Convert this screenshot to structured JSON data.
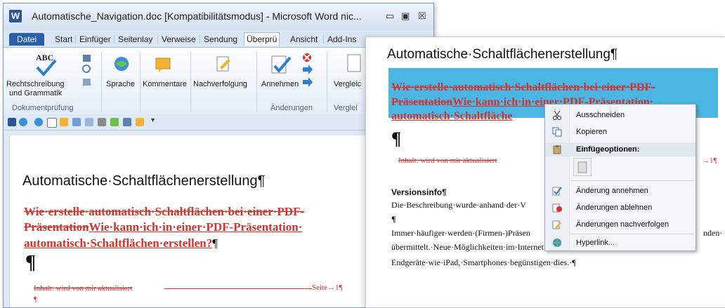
{
  "window": {
    "app_icon_letter": "W",
    "title": "Automatische_Navigation.doc [Kompatibilitätsmodus] - Microsoft Word nic...",
    "controls": [
      "▭",
      "▣",
      "☒"
    ]
  },
  "ribbon_tabs": [
    "Datei",
    "Start",
    "Einfüger",
    "Seitenlay",
    "Verweise",
    "Sendung",
    "Überprü",
    "Ansicht",
    "Add-Ins"
  ],
  "ribbon": {
    "proofing_label_1": "Rechtschreibung",
    "proofing_label_2": "und Grammatik",
    "proofing_group": "Dokumentprüfung",
    "language": "Sprache",
    "comments": "Kommentare",
    "tracking": "Nachverfolgung",
    "accept": "Annehmen",
    "changes_group": "Änderungen",
    "compare": "Vergleic",
    "compare_group": "Verglei"
  },
  "document": {
    "heading": "Automatische·Schaltflächenerstellung¶",
    "struck_line1": "Wie·erstelle·automatisch·Schaltflächen·bei·einer·PDF-",
    "struck_line2a": "Präsentation",
    "inserted_line2b": "Wie·kann·ich·in·einer·PDF-Präsentation·",
    "inserted_line3": "automatisch·Schaltflächen·erstellen?",
    "pilcrow": "¶",
    "toc_entry": "Inhalt: wird von mir aktualisiert",
    "toc_tab": "→",
    "toc_page": "Seite→1¶",
    "small_pilcrow": "¶"
  },
  "zoom_panel": {
    "heading": "Automatische·Schaltflächenerstellung¶",
    "sel_line1": "Wie·erstelle·automatisch·Schaltflächen·bei·einer·PDF-",
    "sel_line2a": "Präsentation",
    "sel_line2b": "Wie·kann·ich·in·einer·PDF-Präsentation·",
    "sel_line3": "automatisch·Schaltfläche",
    "pilcrow": "¶",
    "toc_entry": "Inhalt: wird von mir aktualisiert",
    "toc_end": "→1¶",
    "versions_title": "Versionsinfo¶",
    "versions_text": "Die·Beschreibung·wurde·anhand·der·V",
    "para_mark": "¶",
    "body_line1": "Immer·häufiger·werden·(Firmen-)Präsen",
    "body_line1_end": "nden·",
    "body_line2": "übermittelt.·Neue·Möglichkeiten·im·Internet·wie·z.·B.·Webcode,·mobile·",
    "body_line3": "Endgeräte·wie·iPad,·Smartphones·begünstigen·dies.·¶"
  },
  "context_menu": {
    "cut": "Ausschneiden",
    "copy": "Kopieren",
    "paste_options": "Einfügeoptionen:",
    "accept_change": "Änderung annehmen",
    "reject_changes": "Änderungen ablehnen",
    "track_changes": "Änderungen nachverfolgen",
    "hyperlink": "Hyperlink..."
  },
  "colors": {
    "track_red": "#d7312c",
    "selection_blue": "#4ab6e3",
    "word_blue": "#2b5797"
  }
}
